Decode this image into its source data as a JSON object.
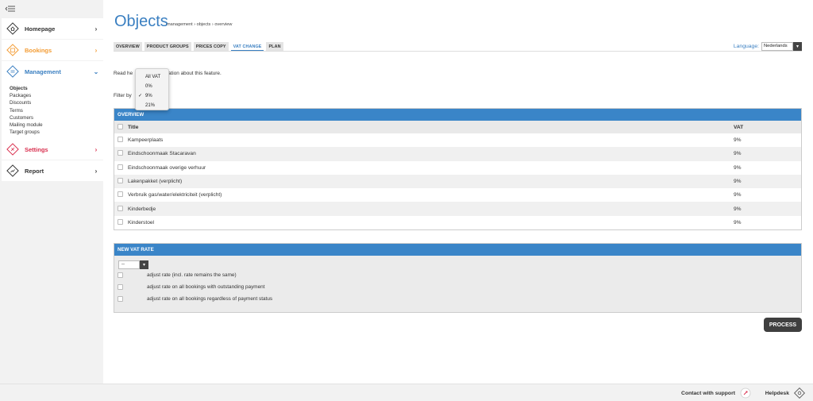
{
  "sidebar": {
    "nav": [
      {
        "label": "Homepage",
        "color": "#333333",
        "icon": "home-icon"
      },
      {
        "label": "Bookings",
        "color": "#f39c34",
        "icon": "bookings-icon"
      },
      {
        "label": "Management",
        "color": "#3a7fc1",
        "icon": "management-icon"
      },
      {
        "label": "Settings",
        "color": "#d9304f",
        "icon": "settings-icon"
      },
      {
        "label": "Report",
        "color": "#333333",
        "icon": "report-icon"
      }
    ],
    "management_items": [
      "Objects",
      "Packages",
      "Discounts",
      "Terms",
      "Customers",
      "Mailing module",
      "Target groups"
    ]
  },
  "page": {
    "title": "Objects",
    "breadcrumb": "management › objects › overview"
  },
  "tabs": [
    "OVERVIEW",
    "PRODUCT GROUPS",
    "PRICES COPY",
    "VAT CHANGE",
    "PLAN"
  ],
  "language": {
    "label": "Language:",
    "value": "Nederlands"
  },
  "info": {
    "part1": "Read he",
    "part2": "formation about this feature."
  },
  "filter": {
    "label": "Filter by"
  },
  "dropdown": {
    "options": [
      "All VAT",
      "0%",
      "9%",
      "21%"
    ],
    "selected": "9%"
  },
  "overview": {
    "heading": "OVERVIEW",
    "columns": {
      "title": "Title",
      "vat": "VAT"
    },
    "rows": [
      {
        "title": "Kampeerplaats",
        "vat": "9%"
      },
      {
        "title": "Eindschoonmaak Stacaravan",
        "vat": "9%"
      },
      {
        "title": "Eindschoonmaak overige verhuur",
        "vat": "9%"
      },
      {
        "title": "Lakenpakket (verplicht)",
        "vat": "9%"
      },
      {
        "title": "Verbruik gas/water/elektriciteit (verplicht)",
        "vat": "9%"
      },
      {
        "title": "Kinderbedje",
        "vat": "9%"
      },
      {
        "title": "Kinderstoel",
        "vat": "9%"
      }
    ]
  },
  "new_vat": {
    "heading": "NEW VAT RATE",
    "select_value": "--",
    "options": [
      "adjust rate (incl. rate remains the same)",
      "adjust rate on all bookings with outstanding payment",
      "adjust rate on all bookings regardless of payment status"
    ]
  },
  "process_button": "PROCESS",
  "footer": {
    "support": "Contact with support",
    "helpdesk": "Helpdesk"
  },
  "colors": {
    "accent": "#3a7fc1",
    "panel_header": "#3a85c8",
    "button": "#3f3f3f"
  }
}
